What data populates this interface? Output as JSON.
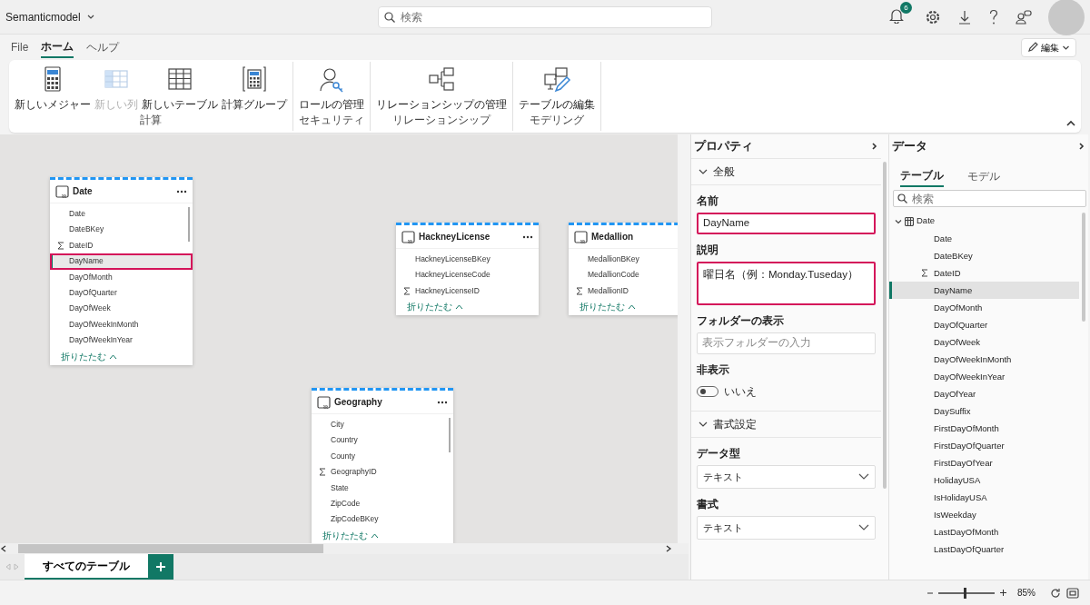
{
  "app": {
    "title": "Semanticmodel",
    "search_placeholder": "検索",
    "notification_count": "6"
  },
  "menu_tabs": [
    {
      "label": "File",
      "selected": false
    },
    {
      "label": "ホーム",
      "selected": true
    },
    {
      "label": "ヘルプ",
      "selected": false
    }
  ],
  "edit_button": {
    "label": "編集"
  },
  "ribbon_groups": [
    {
      "label": "計算",
      "items": [
        {
          "label": "新しいメジャー",
          "disabled": false
        },
        {
          "label": "新しい列",
          "disabled": true
        },
        {
          "label": "新しいテーブル",
          "disabled": false
        },
        {
          "label": "計算グループ",
          "disabled": false
        }
      ]
    },
    {
      "label": "セキュリティ",
      "items": [
        {
          "label": "ロールの管理",
          "disabled": false
        }
      ]
    },
    {
      "label": "リレーションシップ",
      "items": [
        {
          "label": "リレーションシップの管理",
          "disabled": false
        }
      ]
    },
    {
      "label": "モデリング",
      "items": [
        {
          "label": "テーブルの編集",
          "disabled": false
        }
      ]
    }
  ],
  "tables": [
    {
      "name": "Date",
      "collapse": "折りたたむ",
      "columns": [
        {
          "name": "Date",
          "kind": "column",
          "selected": false,
          "highlighted": false
        },
        {
          "name": "DateBKey",
          "kind": "column",
          "selected": false,
          "highlighted": false
        },
        {
          "name": "DateID",
          "kind": "sum",
          "selected": false,
          "highlighted": false
        },
        {
          "name": "DayName",
          "kind": "column",
          "selected": true,
          "highlighted": true
        },
        {
          "name": "DayOfMonth",
          "kind": "column",
          "selected": false,
          "highlighted": false
        },
        {
          "name": "DayOfQuarter",
          "kind": "column",
          "selected": false,
          "highlighted": false
        },
        {
          "name": "DayOfWeek",
          "kind": "column",
          "selected": false,
          "highlighted": false
        },
        {
          "name": "DayOfWeekInMonth",
          "kind": "column",
          "selected": false,
          "highlighted": false
        },
        {
          "name": "DayOfWeekInYear",
          "kind": "column",
          "selected": false,
          "highlighted": false
        }
      ]
    },
    {
      "name": "HackneyLicense",
      "collapse": "折りたたむ",
      "columns": [
        {
          "name": "HackneyLicenseBKey",
          "kind": "column",
          "selected": false,
          "highlighted": false
        },
        {
          "name": "HackneyLicenseCode",
          "kind": "column",
          "selected": false,
          "highlighted": false
        },
        {
          "name": "HackneyLicenseID",
          "kind": "sum",
          "selected": false,
          "highlighted": false
        }
      ]
    },
    {
      "name": "Medallion",
      "collapse": "折りたたむ",
      "columns": [
        {
          "name": "MedallionBKey",
          "kind": "column",
          "selected": false,
          "highlighted": false
        },
        {
          "name": "MedallionCode",
          "kind": "column",
          "selected": false,
          "highlighted": false
        },
        {
          "name": "MedallionID",
          "kind": "sum",
          "selected": false,
          "highlighted": false
        }
      ]
    },
    {
      "name": "Geography",
      "collapse": "折りたたむ",
      "columns": [
        {
          "name": "City",
          "kind": "column",
          "selected": false,
          "highlighted": false
        },
        {
          "name": "Country",
          "kind": "column",
          "selected": false,
          "highlighted": false
        },
        {
          "name": "County",
          "kind": "column",
          "selected": false,
          "highlighted": false
        },
        {
          "name": "GeographyID",
          "kind": "sum",
          "selected": false,
          "highlighted": false
        },
        {
          "name": "State",
          "kind": "column",
          "selected": false,
          "highlighted": false
        },
        {
          "name": "ZipCode",
          "kind": "column",
          "selected": false,
          "highlighted": false
        },
        {
          "name": "ZipCodeBKey",
          "kind": "column",
          "selected": false,
          "highlighted": false
        }
      ]
    }
  ],
  "canvas_tabs": [
    {
      "label": "すべてのテーブル",
      "selected": true
    }
  ],
  "properties": {
    "title": "プロパティ",
    "sections": [
      {
        "label": "全般",
        "expanded": true,
        "fields": [
          {
            "kind": "text",
            "label": "名前",
            "value": "DayName",
            "highlighted": true
          },
          {
            "kind": "textarea",
            "label": "説明",
            "value": "曜日名（例：Monday.Tuseday）",
            "highlighted": true
          },
          {
            "kind": "text",
            "label": "フォルダーの表示",
            "placeholder": "表示フォルダーの入力",
            "highlighted": false
          },
          {
            "kind": "toggle",
            "label": "非表示",
            "on": false,
            "state_label": "いいえ"
          }
        ]
      },
      {
        "label": "書式設定",
        "expanded": true,
        "fields": [
          {
            "kind": "select",
            "label": "データ型",
            "value": "テキスト"
          },
          {
            "kind": "select",
            "label": "書式",
            "value": "テキスト"
          }
        ]
      }
    ]
  },
  "data_panel": {
    "title": "データ",
    "tabs": [
      {
        "label": "テーブル",
        "selected": true
      },
      {
        "label": "モデル",
        "selected": false
      }
    ],
    "search_placeholder": "検索",
    "tree": [
      {
        "name": "Date",
        "expanded": true,
        "children": [
          {
            "name": "Date",
            "kind": "column",
            "selected": false
          },
          {
            "name": "DateBKey",
            "kind": "column",
            "selected": false
          },
          {
            "name": "DateID",
            "kind": "sum",
            "selected": false
          },
          {
            "name": "DayName",
            "kind": "column",
            "selected": true
          },
          {
            "name": "DayOfMonth",
            "kind": "column",
            "selected": false
          },
          {
            "name": "DayOfQuarter",
            "kind": "column",
            "selected": false
          },
          {
            "name": "DayOfWeek",
            "kind": "column",
            "selected": false
          },
          {
            "name": "DayOfWeekInMonth",
            "kind": "column",
            "selected": false
          },
          {
            "name": "DayOfWeekInYear",
            "kind": "column",
            "selected": false
          },
          {
            "name": "DayOfYear",
            "kind": "column",
            "selected": false
          },
          {
            "name": "DaySuffix",
            "kind": "column",
            "selected": false
          },
          {
            "name": "FirstDayOfMonth",
            "kind": "column",
            "selected": false
          },
          {
            "name": "FirstDayOfQuarter",
            "kind": "column",
            "selected": false
          },
          {
            "name": "FirstDayOfYear",
            "kind": "column",
            "selected": false
          },
          {
            "name": "HolidayUSA",
            "kind": "column",
            "selected": false
          },
          {
            "name": "IsHolidayUSA",
            "kind": "column",
            "selected": false
          },
          {
            "name": "IsWeekday",
            "kind": "column",
            "selected": false
          },
          {
            "name": "LastDayOfMonth",
            "kind": "column",
            "selected": false
          },
          {
            "name": "LastDayOfQuarter",
            "kind": "column",
            "selected": false
          }
        ]
      }
    ]
  },
  "zoom": {
    "level": 0.45,
    "reading": "85%"
  }
}
